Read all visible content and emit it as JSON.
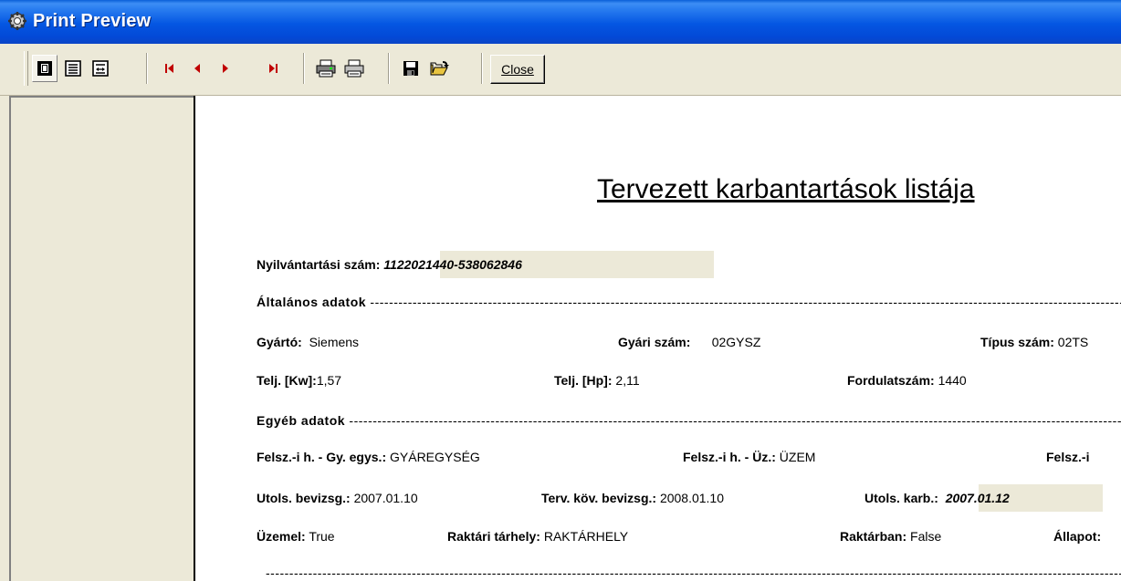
{
  "window": {
    "title": "Print Preview"
  },
  "toolbar": {
    "close_label": "Close"
  },
  "report": {
    "title": "Tervezett karbantartások listája",
    "reg_label": "Nyilvántartási szám:",
    "reg_value": "1122021440-538062846",
    "general_header": "Általános adatok",
    "other_header": "Egyéb adatok",
    "manufacturer_label": "Gyártó:",
    "manufacturer_value": "Siemens",
    "serial_label": "Gyári szám:",
    "serial_value": "02GYSZ",
    "type_label": "Típus szám:",
    "type_value": "02TS",
    "power_kw_label": "Telj. [Kw]:",
    "power_kw_value": "1,57",
    "power_hp_label": "Telj. [Hp]:",
    "power_hp_value": "2,11",
    "rpm_label": "Fordulatszám:",
    "rpm_value": "1440",
    "unit_label": "Felsz.-i h. - Gy. egys.:",
    "unit_value": "GYÁREGYSÉG",
    "plant_label": "Felsz.-i h. - Üz.:",
    "plant_value": "ÜZEM",
    "felsz_cut_label": "Felsz.-i",
    "last_insp_label": "Utols. bevizsg.:",
    "last_insp_value": "2007.01.10",
    "next_insp_label": "Terv. köv. bevizsg.:",
    "next_insp_value": "2008.01.10",
    "last_maint_label": "Utols. karb.:",
    "last_maint_value": "2007.01.12",
    "operating_label": "Üzemel:",
    "operating_value": "True",
    "storage_label": "Raktári tárhely:",
    "storage_value": "RAKTÁRHELY",
    "in_stock_label": "Raktárban:",
    "in_stock_value": "False",
    "status_cut_label": "Állapot:"
  }
}
